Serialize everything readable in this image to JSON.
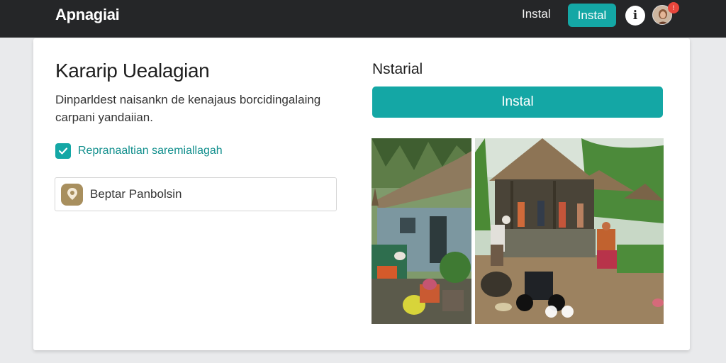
{
  "header": {
    "app_title": "Apnagiai",
    "nav_link": "Instal",
    "install_button": "Instal",
    "info_icon": "info-icon",
    "avatar": "user-avatar"
  },
  "left": {
    "title": "Kararip Uealagian",
    "description": "Dinparldest naisankn de kenajaus borcidingalaing carpani yandaiian.",
    "checkbox": {
      "label": "Repranaaltian saremiallagah",
      "checked": true
    },
    "field": {
      "label": "Beptar Panbolsin",
      "icon": "location-pin-icon"
    }
  },
  "right": {
    "title": "Nstarial",
    "install_button": "Instal",
    "carousel_dots": 2
  },
  "colors": {
    "accent": "#14a7a5",
    "topbar": "#252628",
    "notification": "#e8463c"
  }
}
